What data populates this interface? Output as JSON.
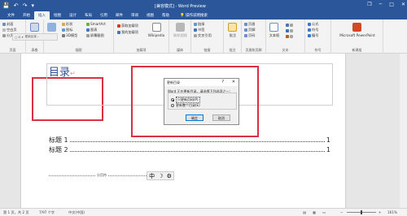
{
  "titlebar": {
    "title": "[兼容模式] - Word Preview",
    "qat": [
      "💾",
      "↶",
      "↷",
      "▾"
    ],
    "controls": {
      "restore": "❐",
      "minimize": "─",
      "maximize": "□",
      "close": "✕"
    }
  },
  "tabs": [
    "文件",
    "开始",
    "插入",
    "绘图",
    "设计",
    "布局",
    "引用",
    "邮件",
    "审阅",
    "视图",
    "帮助"
  ],
  "active_tab": "插入",
  "tell_me": "操作说明搜索",
  "ribbon": {
    "pages": {
      "cover": "封面",
      "blank": "空白页",
      "break": "分页",
      "group": "页面"
    },
    "table": {
      "label": "表格",
      "group": "表格"
    },
    "illustrations": {
      "pictures": "图片",
      "shapes": "形状",
      "icons": "图标",
      "models": "3D模型",
      "smartart": "SmartArt",
      "chart": "图表",
      "screenshot": "屏幕截图",
      "group": "插图"
    },
    "addins": {
      "get": "获取加载项",
      "my": "我的加载项",
      "wikipedia": "Wikipedia",
      "group": "加载项"
    },
    "media": {
      "video": "联机视频",
      "group": "媒体"
    },
    "links": {
      "link": "链接",
      "bookmark": "书签",
      "crossref": "交叉引用",
      "group": "链接"
    },
    "comments": {
      "comment": "批注",
      "group": "批注"
    },
    "header_footer": {
      "header": "页眉",
      "footer": "页脚",
      "page_number": "页码",
      "group": "页眉和页脚"
    },
    "text": {
      "textbox": "文本框",
      "group": "文本"
    },
    "symbols": {
      "equation": "公式",
      "symbol": "符号",
      "number": "编号",
      "group": "符号"
    },
    "new_group": {
      "ppt": "Microsoft PowerPoint",
      "group": "新建组"
    }
  },
  "document": {
    "header_toolbar": {
      "icons": "▢ ⊟ ▾",
      "label": "更新目录..."
    },
    "toc_title": "目录",
    "entries": [
      {
        "label": "标题 1",
        "page": "1"
      },
      {
        "label": "标题 2",
        "page": "1"
      }
    ],
    "para_mark": "↵",
    "section_break": "分页符",
    "ime_text": "中",
    "ime_icons": [
      "☽",
      "⚙"
    ]
  },
  "dialog": {
    "title": "更新目录",
    "help": "?",
    "close": "✕",
    "message": "Word 正在更新目录，请选择下列选项之一：",
    "options": [
      {
        "label": "只更新页码(P)",
        "selected": true
      },
      {
        "label": "更新整个目录(E)",
        "selected": false
      }
    ],
    "ok": "确定",
    "cancel": "取消"
  },
  "status": {
    "page": "第 1 页，共 2 页",
    "words": "7/97 个字",
    "lang": "中文(中国)",
    "zoom": "161%"
  },
  "colors": {
    "accent": "#2b579a",
    "highlight": "#d9313f",
    "heading": "#2f5496"
  }
}
